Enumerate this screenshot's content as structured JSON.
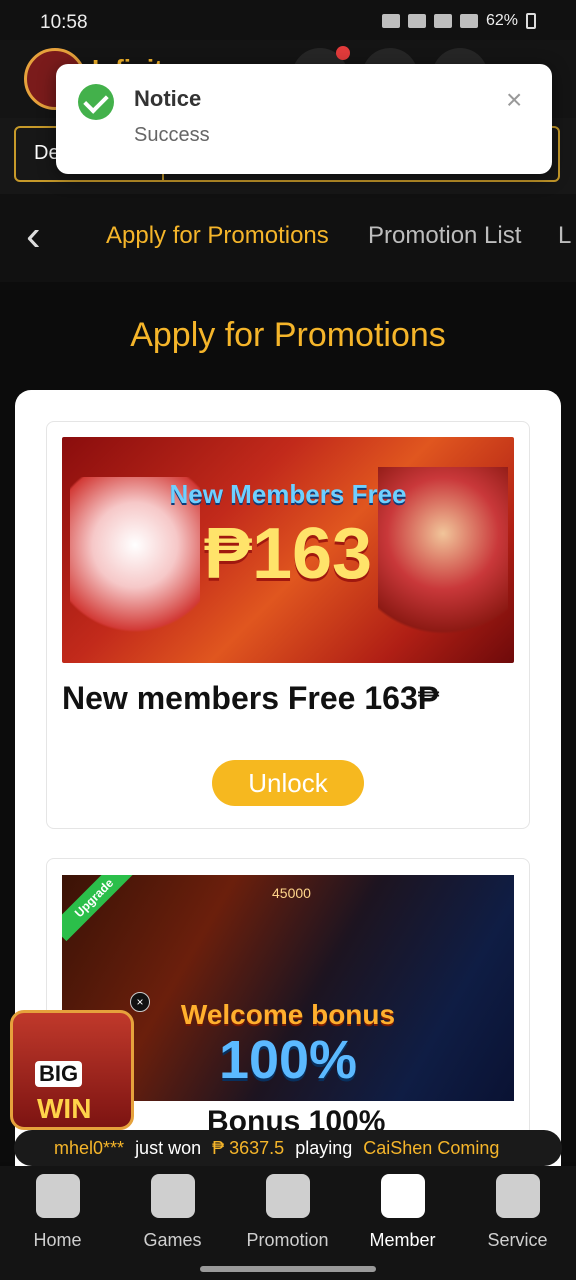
{
  "status_bar": {
    "time": "10:58",
    "battery": "62%"
  },
  "header": {
    "logo_text": "Infinity"
  },
  "toolbar": {
    "deposit_label": "De"
  },
  "toast": {
    "title": "Notice",
    "message": "Success",
    "close_icon": "×",
    "check_icon": "check-circle-icon"
  },
  "tabs": {
    "back_icon": "‹",
    "items": [
      {
        "label": "Apply for Promotions",
        "active": true
      },
      {
        "label": "Promotion List",
        "active": false
      },
      {
        "label": "L",
        "active": false
      }
    ]
  },
  "page": {
    "title": "Apply for Promotions"
  },
  "promotions": [
    {
      "banner_caption": "New Members Free",
      "banner_amount": "₱163",
      "title": "New members Free 163₱",
      "button_label": "Unlock"
    },
    {
      "banner_ribbon": "Upgrade",
      "banner_top": "45000",
      "banner_caption": "Welcome bonus",
      "banner_pct": "100%",
      "title": "Bonus 100%"
    }
  ],
  "bigwin": {
    "line1": "BIG",
    "line2": "WIN",
    "close": "×"
  },
  "ticker": {
    "user": "mhel0***",
    "text1": "just won",
    "amount": "₱ 3637.5",
    "text2": "playing",
    "game": "CaiShen Coming"
  },
  "nav": [
    {
      "label": "Home",
      "icon": "home-icon"
    },
    {
      "label": "Games",
      "icon": "gamepad-icon"
    },
    {
      "label": "Promotion",
      "icon": "gift-icon"
    },
    {
      "label": "Member",
      "icon": "member-icon",
      "active": true
    },
    {
      "label": "Service",
      "icon": "headset-icon"
    }
  ],
  "colors": {
    "accent": "#f5b52a",
    "success": "#43b14b",
    "button": "#f6b81f"
  }
}
